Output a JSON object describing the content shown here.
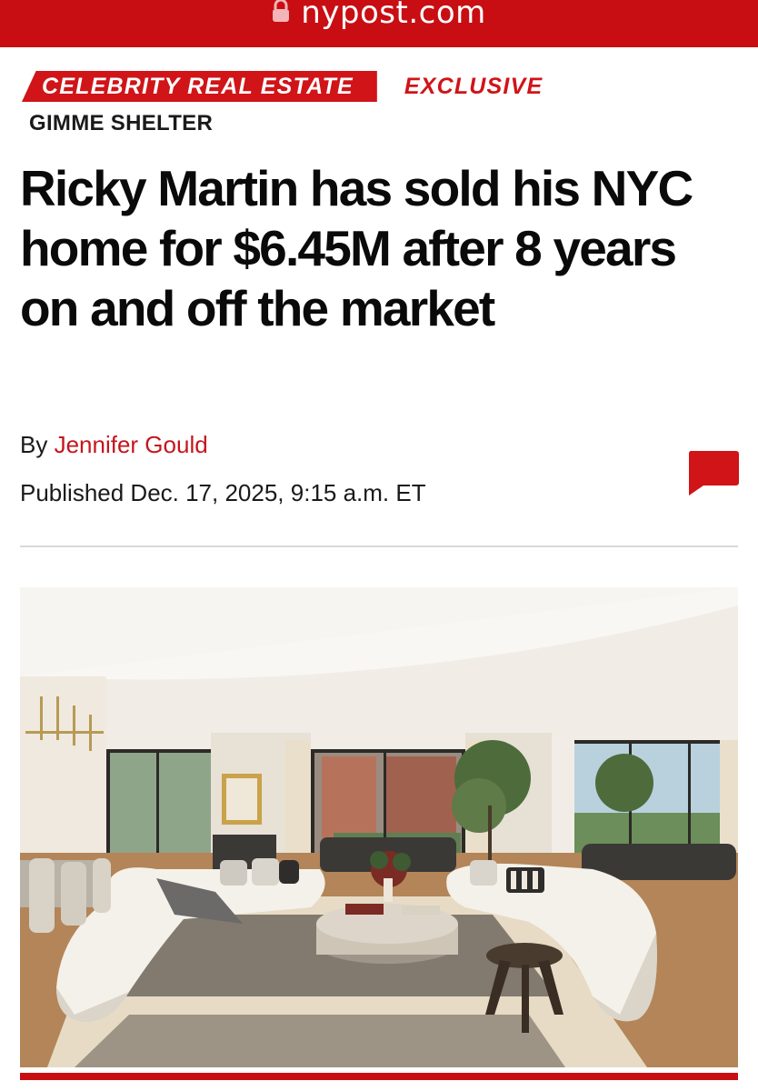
{
  "browser": {
    "url": "nypost.com",
    "lock_icon": "lock-icon"
  },
  "article": {
    "category_tag": "CELEBRITY REAL ESTATE",
    "exclusive_tag": "EXCLUSIVE",
    "kicker": "GIMME SHELTER",
    "headline": "Ricky Martin has sold his NYC home for $6.45M after 8 years on and off the market",
    "byline_prefix": "By",
    "author": "Jennifer Gould",
    "published": "Published Dec. 17, 2025, 9:15 a.m. ET",
    "comment_icon": "comment-icon"
  },
  "colors": {
    "brand_red": "#c80e13",
    "tag_red": "#d01418",
    "author_red": "#c4161c"
  }
}
